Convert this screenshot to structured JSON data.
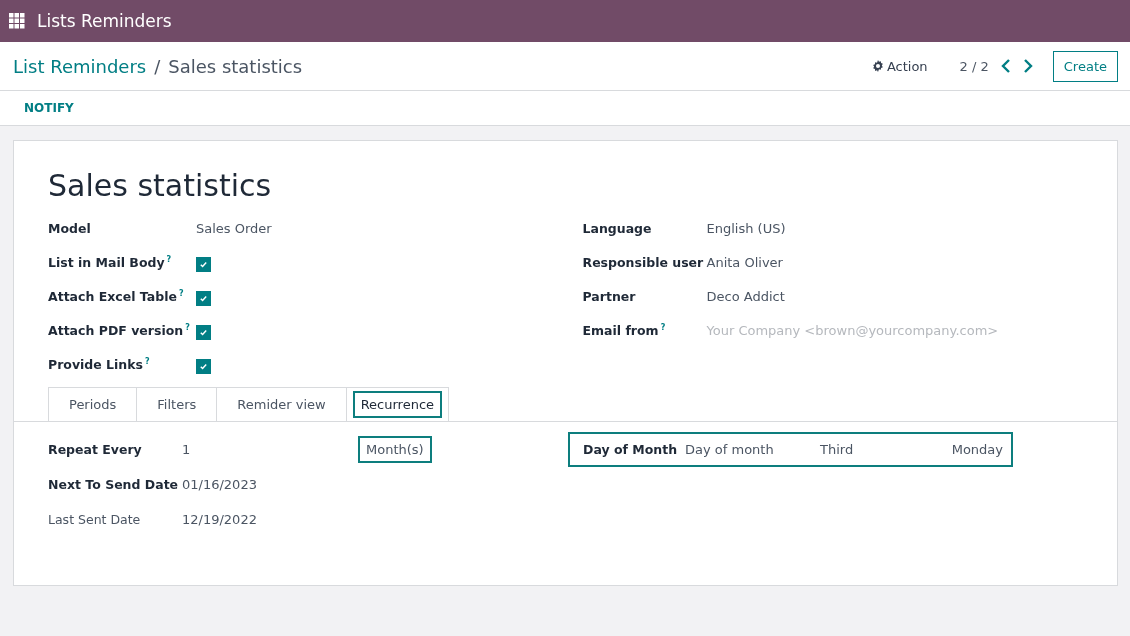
{
  "app_bar": {
    "title": "Lists Reminders"
  },
  "breadcrumb": {
    "parent": "List Reminders",
    "separator": "/",
    "current": "Sales statistics"
  },
  "control_panel": {
    "action": "Action",
    "pager": "2 / 2",
    "create": "Create"
  },
  "status_bar": {
    "buttons": [
      "NOTIFY"
    ]
  },
  "form": {
    "title": "Sales statistics",
    "left_fields": [
      {
        "kind": "text",
        "label": "Model",
        "value": "Sales Order"
      },
      {
        "kind": "checkbox",
        "label": "List in Mail Body",
        "help": "?",
        "checked": true
      },
      {
        "kind": "checkbox",
        "label": "Attach Excel Table",
        "help": "?",
        "checked": true
      },
      {
        "kind": "checkbox",
        "label": "Attach PDF version",
        "help": "?",
        "checked": true
      },
      {
        "kind": "checkbox",
        "label": "Provide Links",
        "help": "?",
        "checked": true
      }
    ],
    "right_fields": [
      {
        "kind": "text",
        "label": "Language",
        "value": "English (US)"
      },
      {
        "kind": "text",
        "label": "Responsible user",
        "value": "Anita Oliver"
      },
      {
        "kind": "text",
        "label": "Partner",
        "value": "Deco Addict"
      },
      {
        "kind": "placeholder",
        "label": "Email from",
        "help": "?",
        "placeholder": "Your Company <brown@yourcompany.com>"
      }
    ],
    "tabs": [
      {
        "label": "Periods",
        "selected": false,
        "highlighted": false
      },
      {
        "label": "Filters",
        "selected": false,
        "highlighted": false
      },
      {
        "label": "Remider view",
        "selected": false,
        "highlighted": false
      },
      {
        "label": "Recurrence",
        "selected": true,
        "highlighted": true
      }
    ],
    "recurrence": {
      "repeat_every": {
        "label": "Repeat Every",
        "value": "1",
        "unit": "Month(s)",
        "unit_highlighted": true
      },
      "next_send": {
        "label": "Next To Send Date",
        "value": "01/16/2023",
        "readonly": false
      },
      "last_sent": {
        "label": "Last Sent Date",
        "value": "12/19/2022",
        "readonly": true
      },
      "day_of_month": {
        "label": "Day of Month",
        "highlighted": true,
        "values": [
          "Day of month",
          "Third",
          "Monday"
        ]
      }
    }
  }
}
